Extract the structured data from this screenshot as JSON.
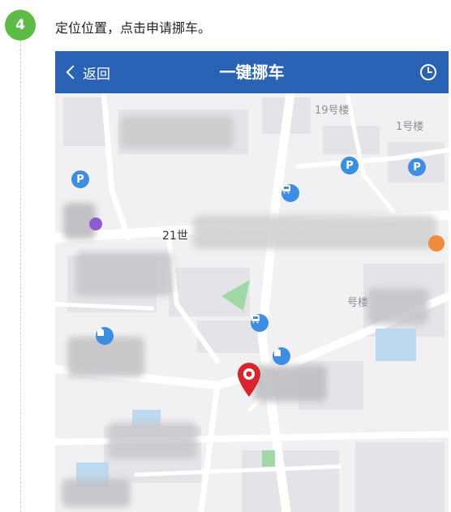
{
  "step": {
    "number": "4",
    "title": "定位位置，点击申请挪车。"
  },
  "app": {
    "back_label": "返回",
    "title": "一键挪车",
    "history_icon": "clock-icon",
    "accent_color": "#2a63b5"
  },
  "map": {
    "labels": {
      "building_19": "19号楼",
      "building_1": "1号楼",
      "road_21": "21世",
      "building_partial": "号楼"
    },
    "pin_icon": "location-pin-icon",
    "pin_color": "#d9232d",
    "parking_symbol": "P"
  }
}
